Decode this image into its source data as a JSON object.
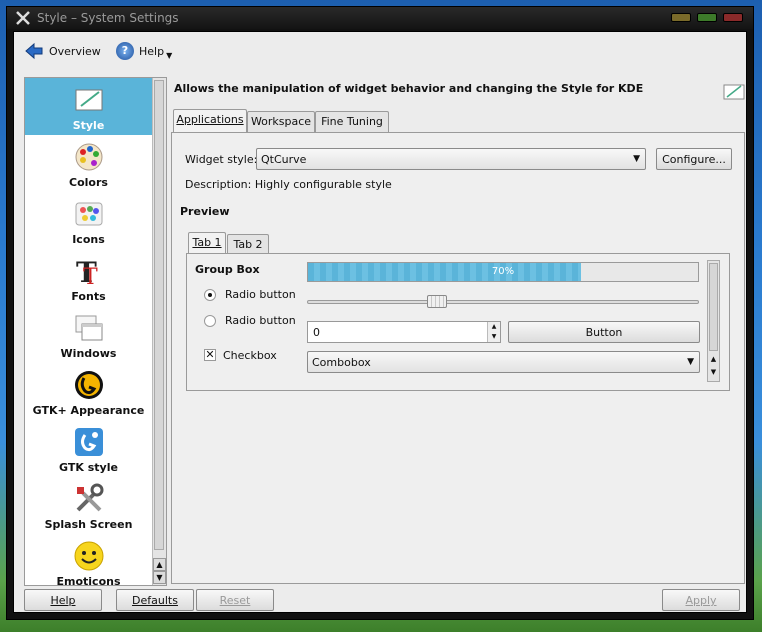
{
  "window": {
    "title": "Style – System Settings"
  },
  "toolbar": {
    "overview_label": "Overview",
    "help_label": "Help"
  },
  "sidebar": {
    "items": [
      {
        "label": "Style",
        "icon": "style-icon"
      },
      {
        "label": "Colors",
        "icon": "colors-icon"
      },
      {
        "label": "Icons",
        "icon": "icons-icon"
      },
      {
        "label": "Fonts",
        "icon": "fonts-icon"
      },
      {
        "label": "Windows",
        "icon": "windows-icon"
      },
      {
        "label": "GTK+ Appearance",
        "icon": "gtk-appearance-icon"
      },
      {
        "label": "GTK style",
        "icon": "gtk-style-icon"
      },
      {
        "label": "Splash Screen",
        "icon": "splash-screen-icon"
      },
      {
        "label": "Emoticons",
        "icon": "emoticons-icon"
      }
    ]
  },
  "main": {
    "heading": "Allows the manipulation of widget behavior and changing the Style for KDE",
    "tabs": [
      "Applications",
      "Workspace",
      "Fine Tuning"
    ],
    "widget_style_label": "Widget style:",
    "widget_style_value": "QtCurve",
    "configure_label": "Configure...",
    "description": "Description: Highly configurable style",
    "preview_label": "Preview",
    "preview": {
      "tabs": [
        "Tab 1",
        "Tab 2"
      ],
      "group_box_label": "Group Box",
      "radio1": "Radio button",
      "radio2": "Radio button",
      "checkbox": "Checkbox",
      "progress_text": "70%",
      "progress_value": 70,
      "slider_value": 0.32,
      "spin_value": "0",
      "button_label": "Button",
      "combobox_value": "Combobox"
    }
  },
  "bottom": {
    "help": "Help",
    "defaults": "Defaults",
    "reset": "Reset",
    "apply": "Apply"
  },
  "colors": {
    "selection": "#5ab4d9",
    "progress": "#5ab4d9"
  }
}
